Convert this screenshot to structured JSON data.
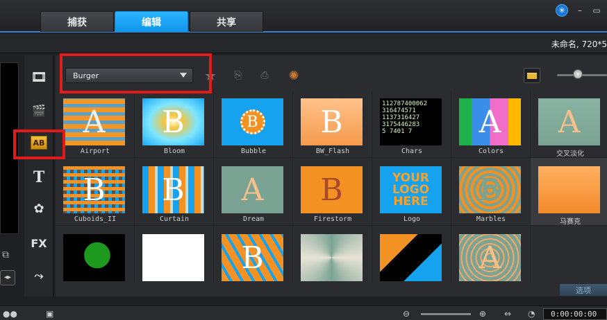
{
  "tabs": [
    {
      "label": "捕获",
      "active": false
    },
    {
      "label": "编辑",
      "active": true
    },
    {
      "label": "共享",
      "active": false
    }
  ],
  "window": {
    "globe_icon": "globe-icon",
    "minimize": "–",
    "restore": "▭"
  },
  "project": {
    "info": "未命名, 720*5"
  },
  "library": {
    "category_selected": "Burger",
    "items": [
      {
        "name": "Airport"
      },
      {
        "name": "Bloom"
      },
      {
        "name": "Bubble"
      },
      {
        "name": "BW_Flash"
      },
      {
        "name": "Chars"
      },
      {
        "name": "Colors"
      },
      {
        "name": "交叉淡化"
      },
      {
        "name": "Cuboids_II"
      },
      {
        "name": "Curtain"
      },
      {
        "name": "Dream"
      },
      {
        "name": "Firestorm"
      },
      {
        "name": "Logo"
      },
      {
        "name": "Marbles"
      },
      {
        "name": "马赛克"
      },
      {
        "name": ""
      },
      {
        "name": ""
      },
      {
        "name": ""
      },
      {
        "name": ""
      },
      {
        "name": ""
      },
      {
        "name": ""
      }
    ],
    "chars_digits": "112787400062\n316474571\n1137316427\n3175446283\n5 7401 7",
    "logo_text": "YOUR LOGO HERE",
    "thumb_letter": "B",
    "thumb_letter_a": "A"
  },
  "sidebar": {
    "ab_label": "AB",
    "title_label": "T",
    "fx_label": "FX"
  },
  "footer": {
    "options_label": "选项"
  },
  "timeline": {
    "timecode": "0:00:00:00"
  },
  "colors": {
    "accent": "#17a4f5",
    "highlight_box": "#e11b1b"
  }
}
